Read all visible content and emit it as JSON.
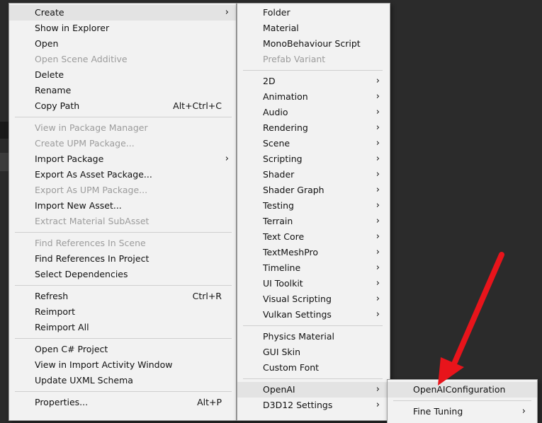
{
  "main_menu": {
    "items": [
      {
        "label": "Create",
        "shortcut": "",
        "submenu": true,
        "disabled": false,
        "highlighted": true
      },
      {
        "label": "Show in Explorer",
        "shortcut": "",
        "submenu": false,
        "disabled": false
      },
      {
        "label": "Open",
        "shortcut": "",
        "submenu": false,
        "disabled": false
      },
      {
        "label": "Open Scene Additive",
        "shortcut": "",
        "submenu": false,
        "disabled": true
      },
      {
        "label": "Delete",
        "shortcut": "",
        "submenu": false,
        "disabled": false
      },
      {
        "label": "Rename",
        "shortcut": "",
        "submenu": false,
        "disabled": false
      },
      {
        "label": "Copy Path",
        "shortcut": "Alt+Ctrl+C",
        "submenu": false,
        "disabled": false
      },
      {
        "label": "View in Package Manager",
        "shortcut": "",
        "submenu": false,
        "disabled": true
      },
      {
        "label": "Create UPM Package...",
        "shortcut": "",
        "submenu": false,
        "disabled": true
      },
      {
        "label": "Import Package",
        "shortcut": "",
        "submenu": true,
        "disabled": false
      },
      {
        "label": "Export As Asset Package...",
        "shortcut": "",
        "submenu": false,
        "disabled": false
      },
      {
        "label": "Export As UPM Package...",
        "shortcut": "",
        "submenu": false,
        "disabled": true
      },
      {
        "label": "Import New Asset...",
        "shortcut": "",
        "submenu": false,
        "disabled": false
      },
      {
        "label": "Extract Material SubAsset",
        "shortcut": "",
        "submenu": false,
        "disabled": true
      },
      {
        "label": "Find References In Scene",
        "shortcut": "",
        "submenu": false,
        "disabled": true
      },
      {
        "label": "Find References In Project",
        "shortcut": "",
        "submenu": false,
        "disabled": false
      },
      {
        "label": "Select Dependencies",
        "shortcut": "",
        "submenu": false,
        "disabled": false
      },
      {
        "label": "Refresh",
        "shortcut": "Ctrl+R",
        "submenu": false,
        "disabled": false
      },
      {
        "label": "Reimport",
        "shortcut": "",
        "submenu": false,
        "disabled": false
      },
      {
        "label": "Reimport All",
        "shortcut": "",
        "submenu": false,
        "disabled": false
      },
      {
        "label": "Open C# Project",
        "shortcut": "",
        "submenu": false,
        "disabled": false
      },
      {
        "label": "View in Import Activity Window",
        "shortcut": "",
        "submenu": false,
        "disabled": false
      },
      {
        "label": "Update UXML Schema",
        "shortcut": "",
        "submenu": false,
        "disabled": false
      },
      {
        "label": "Properties...",
        "shortcut": "Alt+P",
        "submenu": false,
        "disabled": false
      }
    ]
  },
  "create_menu": {
    "items": [
      {
        "label": "Folder",
        "submenu": false,
        "disabled": false
      },
      {
        "label": "Material",
        "submenu": false,
        "disabled": false
      },
      {
        "label": "MonoBehaviour Script",
        "submenu": false,
        "disabled": false
      },
      {
        "label": "Prefab Variant",
        "submenu": false,
        "disabled": true
      },
      {
        "label": "2D",
        "submenu": true,
        "disabled": false
      },
      {
        "label": "Animation",
        "submenu": true,
        "disabled": false
      },
      {
        "label": "Audio",
        "submenu": true,
        "disabled": false
      },
      {
        "label": "Rendering",
        "submenu": true,
        "disabled": false
      },
      {
        "label": "Scene",
        "submenu": true,
        "disabled": false
      },
      {
        "label": "Scripting",
        "submenu": true,
        "disabled": false
      },
      {
        "label": "Shader",
        "submenu": true,
        "disabled": false
      },
      {
        "label": "Shader Graph",
        "submenu": true,
        "disabled": false
      },
      {
        "label": "Testing",
        "submenu": true,
        "disabled": false
      },
      {
        "label": "Terrain",
        "submenu": true,
        "disabled": false
      },
      {
        "label": "Text Core",
        "submenu": true,
        "disabled": false
      },
      {
        "label": "TextMeshPro",
        "submenu": true,
        "disabled": false
      },
      {
        "label": "Timeline",
        "submenu": true,
        "disabled": false
      },
      {
        "label": "UI Toolkit",
        "submenu": true,
        "disabled": false
      },
      {
        "label": "Visual Scripting",
        "submenu": true,
        "disabled": false
      },
      {
        "label": "Vulkan Settings",
        "submenu": true,
        "disabled": false
      },
      {
        "label": "Physics Material",
        "submenu": false,
        "disabled": false
      },
      {
        "label": "GUI Skin",
        "submenu": false,
        "disabled": false
      },
      {
        "label": "Custom Font",
        "submenu": false,
        "disabled": false
      },
      {
        "label": "OpenAI",
        "submenu": true,
        "disabled": false,
        "highlighted": true
      },
      {
        "label": "D3D12 Settings",
        "submenu": true,
        "disabled": false
      }
    ]
  },
  "openai_menu": {
    "items": [
      {
        "label": "OpenAIConfiguration",
        "submenu": false,
        "disabled": false,
        "highlighted": true
      },
      {
        "label": "Fine Tuning",
        "submenu": true,
        "disabled": false
      }
    ]
  },
  "colors": {
    "menu_bg": "#f2f2f2",
    "highlight": "#e3e3e3",
    "disabled_text": "#9c9c9c",
    "annotation_arrow": "#e8141b"
  },
  "icons": {
    "submenu": "chevron-right-icon",
    "annotation": "red-arrow-icon"
  }
}
